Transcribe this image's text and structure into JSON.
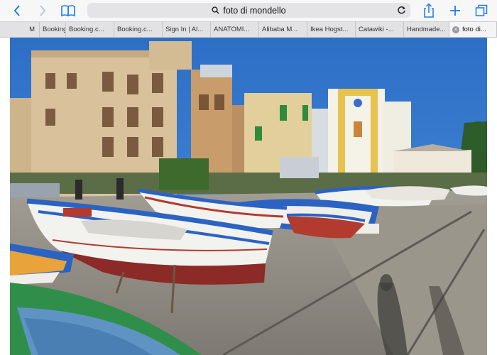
{
  "toolbar": {
    "back_icon": "chevron-left-icon",
    "forward_icon": "chevron-right-icon",
    "bookmarks_icon": "book-icon",
    "address": "foto di mondello",
    "search_icon": "magnifier-icon",
    "reload_icon": "reload-icon",
    "share_icon": "share-icon",
    "new_tab_icon": "plus-icon",
    "tabs_icon": "tabs-icon"
  },
  "tabs": [
    {
      "label": "M"
    },
    {
      "label": "Booking"
    },
    {
      "label": "Booking.c..."
    },
    {
      "label": "Booking.c..."
    },
    {
      "label": "Sign In | Al..."
    },
    {
      "label": "ANATOMI..."
    },
    {
      "label": "Alibaba M..."
    },
    {
      "label": "Ikea Hogst..."
    },
    {
      "label": "Catawiki -..."
    },
    {
      "label": "Handmade..."
    },
    {
      "label": "foto di..."
    }
  ],
  "active_tab_close": "×",
  "photo": {
    "subject": "Fishing boats on the harbor slipway at Mondello with pastel buildings",
    "colors": {
      "sky": "#2f73c9",
      "boat_blue": "#2b63c2",
      "boat_red": "#b23a2e",
      "boat_white": "#f2f2ee",
      "pavement": "#8f8c86",
      "building_beige": "#d8c3a2",
      "building_yellow": "#e8c85a"
    }
  }
}
